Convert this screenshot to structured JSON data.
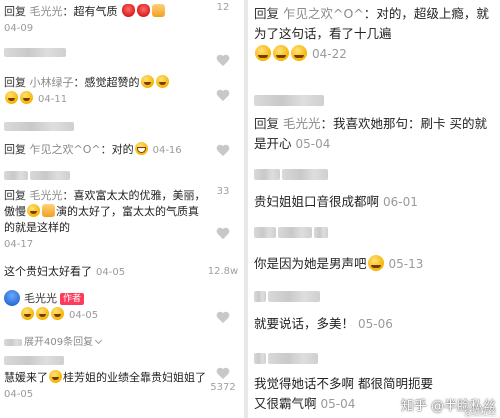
{
  "left": {
    "top_count": "12",
    "comments": [
      {
        "reply": "回复",
        "user": "毛光光",
        "sep": "：",
        "text": "超有气质",
        "date": "04-09"
      },
      {
        "reply": "回复",
        "user": "小林绿子",
        "sep": "：",
        "text": "感觉超赞的",
        "date": "04-11"
      },
      {
        "reply": "回复",
        "user": "乍见之欢^O^",
        "sep": "：",
        "text": "对的",
        "date": "04-16"
      },
      {
        "reply": "回复",
        "user": "毛光光",
        "sep": "：",
        "text1": "喜欢富太太的优雅，美丽，傲慢",
        "text2": "演的太好了，富太太的气质真的就是这样的",
        "date": "04-17"
      },
      {
        "text": "这个贵妇太好看了",
        "date": "04-05"
      }
    ],
    "author": {
      "name": "毛光光",
      "tag": "作者",
      "date": "04-05"
    },
    "expand_label": "展开409条回复",
    "last": {
      "text1": "慧媛来了",
      "text2": "桂芳姐的业绩全靠贵妇姐姐了",
      "date": "04-05"
    },
    "counts": {
      "c33": "33",
      "c128": "12.8w",
      "c5372": "5372"
    }
  },
  "right": {
    "comments": [
      {
        "reply": "回复",
        "user": "乍见之欢^O^",
        "sep": "：",
        "text1": "对的，超级上瘾，就为了这句话，看了十几遍",
        "date": "04-22"
      },
      {
        "reply": "回复",
        "user": "毛光光",
        "sep": "：",
        "text1": "我喜欢她那句：刷卡 买的就是开心",
        "date": "05-04"
      },
      {
        "text": "贵妇姐姐口音很成都啊",
        "date": "06-01"
      },
      {
        "text": "你是因为她是男声吧",
        "date": "05-13"
      },
      {
        "text": "就要说话，多美！",
        "date": "05-06"
      },
      {
        "text1": "我觉得她话不多啊 都很简明扼要",
        "text2": "又很霸气啊",
        "date": "05-04"
      }
    ],
    "watermark": "知乎 @半脸私丝",
    "watermark_badge": "@狐私丝"
  }
}
